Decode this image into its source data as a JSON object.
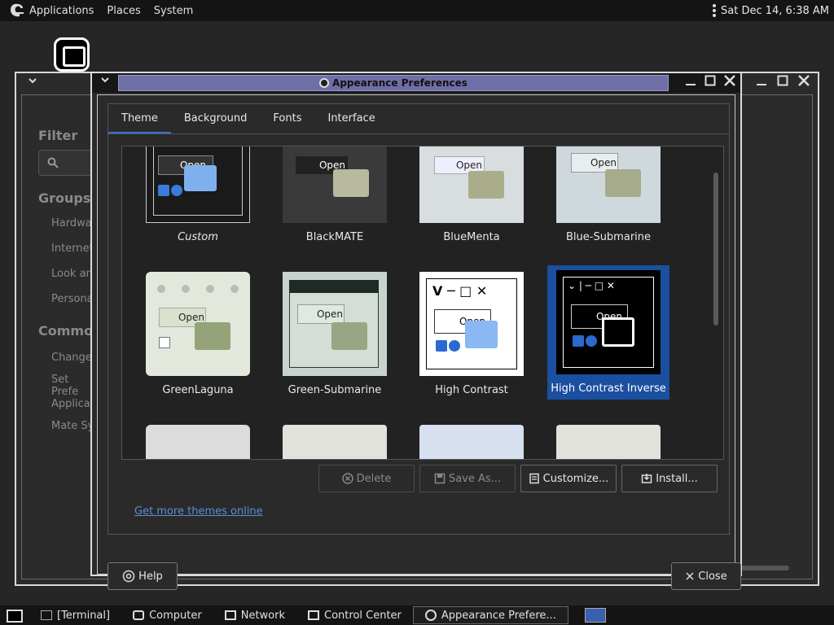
{
  "topbar": {
    "menus": [
      "Applications",
      "Places",
      "System"
    ],
    "clock": "Sat Dec 14,  6:38 AM"
  },
  "background_window": {
    "filter_label": "Filter",
    "groups_label": "Groups",
    "group_items": [
      "Hardware",
      "Internet",
      "Look and",
      "Personal"
    ],
    "common_label": "Common T",
    "common_items": [
      "Change T",
      "Set Prefe Applicatio",
      "Mate Syst"
    ]
  },
  "dialog": {
    "title": "Appearance Preferences",
    "tabs": [
      "Theme",
      "Background",
      "Fonts",
      "Interface"
    ],
    "active_tab": "Theme",
    "themes": [
      {
        "name": "Custom",
        "style": "dark-blue"
      },
      {
        "name": "BlackMATE",
        "style": "dark"
      },
      {
        "name": "BlueMenta",
        "style": "light"
      },
      {
        "name": "Blue-Submarine",
        "style": "light"
      },
      {
        "name": "GreenLaguna",
        "style": "green"
      },
      {
        "name": "Green-Submarine",
        "style": "green-win"
      },
      {
        "name": "High Contrast",
        "style": "hc"
      },
      {
        "name": "High Contrast Inverse",
        "style": "hci",
        "selected": true
      },
      {
        "name": "",
        "style": "partial-gray"
      },
      {
        "name": "",
        "style": "partial-win"
      },
      {
        "name": "",
        "style": "partial-blue"
      },
      {
        "name": "",
        "style": "partial-win"
      }
    ],
    "buttons": {
      "delete": "Delete",
      "save_as": "Save As...",
      "customize": "Customize...",
      "install": "Install..."
    },
    "link": "Get more themes online",
    "help": "Help",
    "close": "Close"
  },
  "taskbar": {
    "items": [
      "[Terminal]",
      "Computer",
      "Network",
      "Control Center",
      "Appearance Prefere..."
    ]
  },
  "colors": {
    "accent": "#3a6fcf",
    "title_bar": "#6f6fa8",
    "selection": "#1b4fa0",
    "link": "#5b8dd8"
  }
}
